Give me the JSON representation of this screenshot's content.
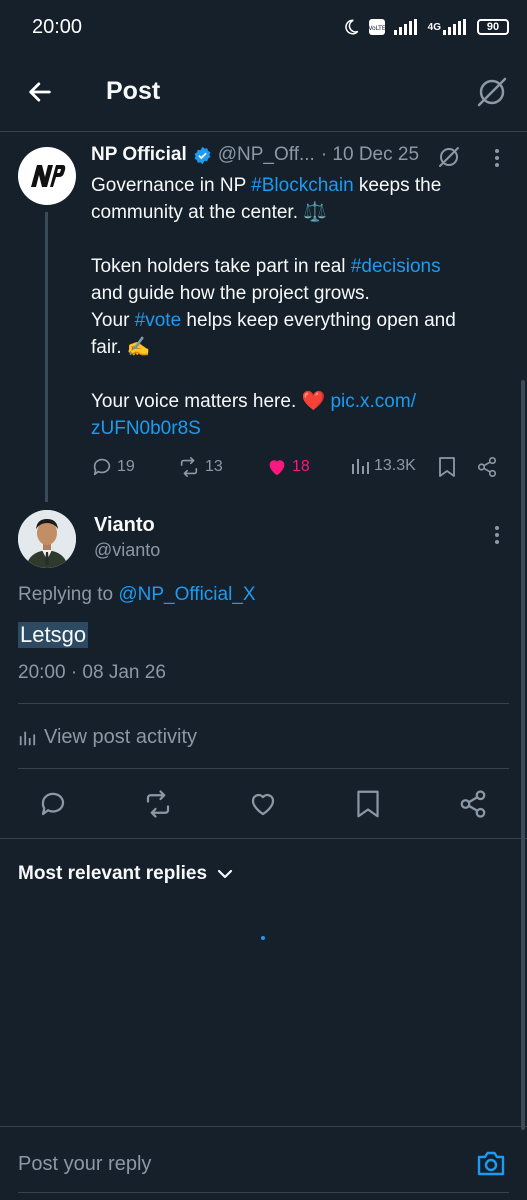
{
  "status_bar": {
    "time": "20:00",
    "network": "4G",
    "battery": "90"
  },
  "header": {
    "title": "Post"
  },
  "post": {
    "author_name": "NP Official",
    "handle": "@NP_Off...",
    "date": "· 10 Dec 25",
    "lines": {
      "l1_pre": "Governance in NP ",
      "l1_tag": "#Blockchain",
      "l1_post": " keeps the",
      "l2": "community at the center. ⚖️",
      "l3": "Token holders take part in real ",
      "l3_tag": "#decisions",
      "l4": "and guide how the project grows.",
      "l5_pre": "Your ",
      "l5_tag": "#vote",
      "l5_post": " helps keep everything open and",
      "l6": "fair. ✍️",
      "l7_pre": "Your voice matters here. ❤️ ",
      "l7_link": "pic.x.com/",
      "l8_link": "zUFN0b0r8S"
    },
    "stats": {
      "replies": "19",
      "reposts": "13",
      "likes": "18",
      "views": "13.3K"
    }
  },
  "reply": {
    "name": "Vianto",
    "handle": "@vianto",
    "replying_prefix": "Replying to ",
    "replying_handle": "@NP_Official_X",
    "text": "Letsgo",
    "time": "20:00 · 08 Jan 26",
    "activity_label": "View post activity"
  },
  "replies_section": {
    "sort_label": "Most relevant replies"
  },
  "composer": {
    "placeholder": "Post your reply"
  },
  "colors": {
    "background": "#15202b",
    "accent": "#1d9bf0",
    "like": "#f91880",
    "muted": "#8b98a5"
  }
}
